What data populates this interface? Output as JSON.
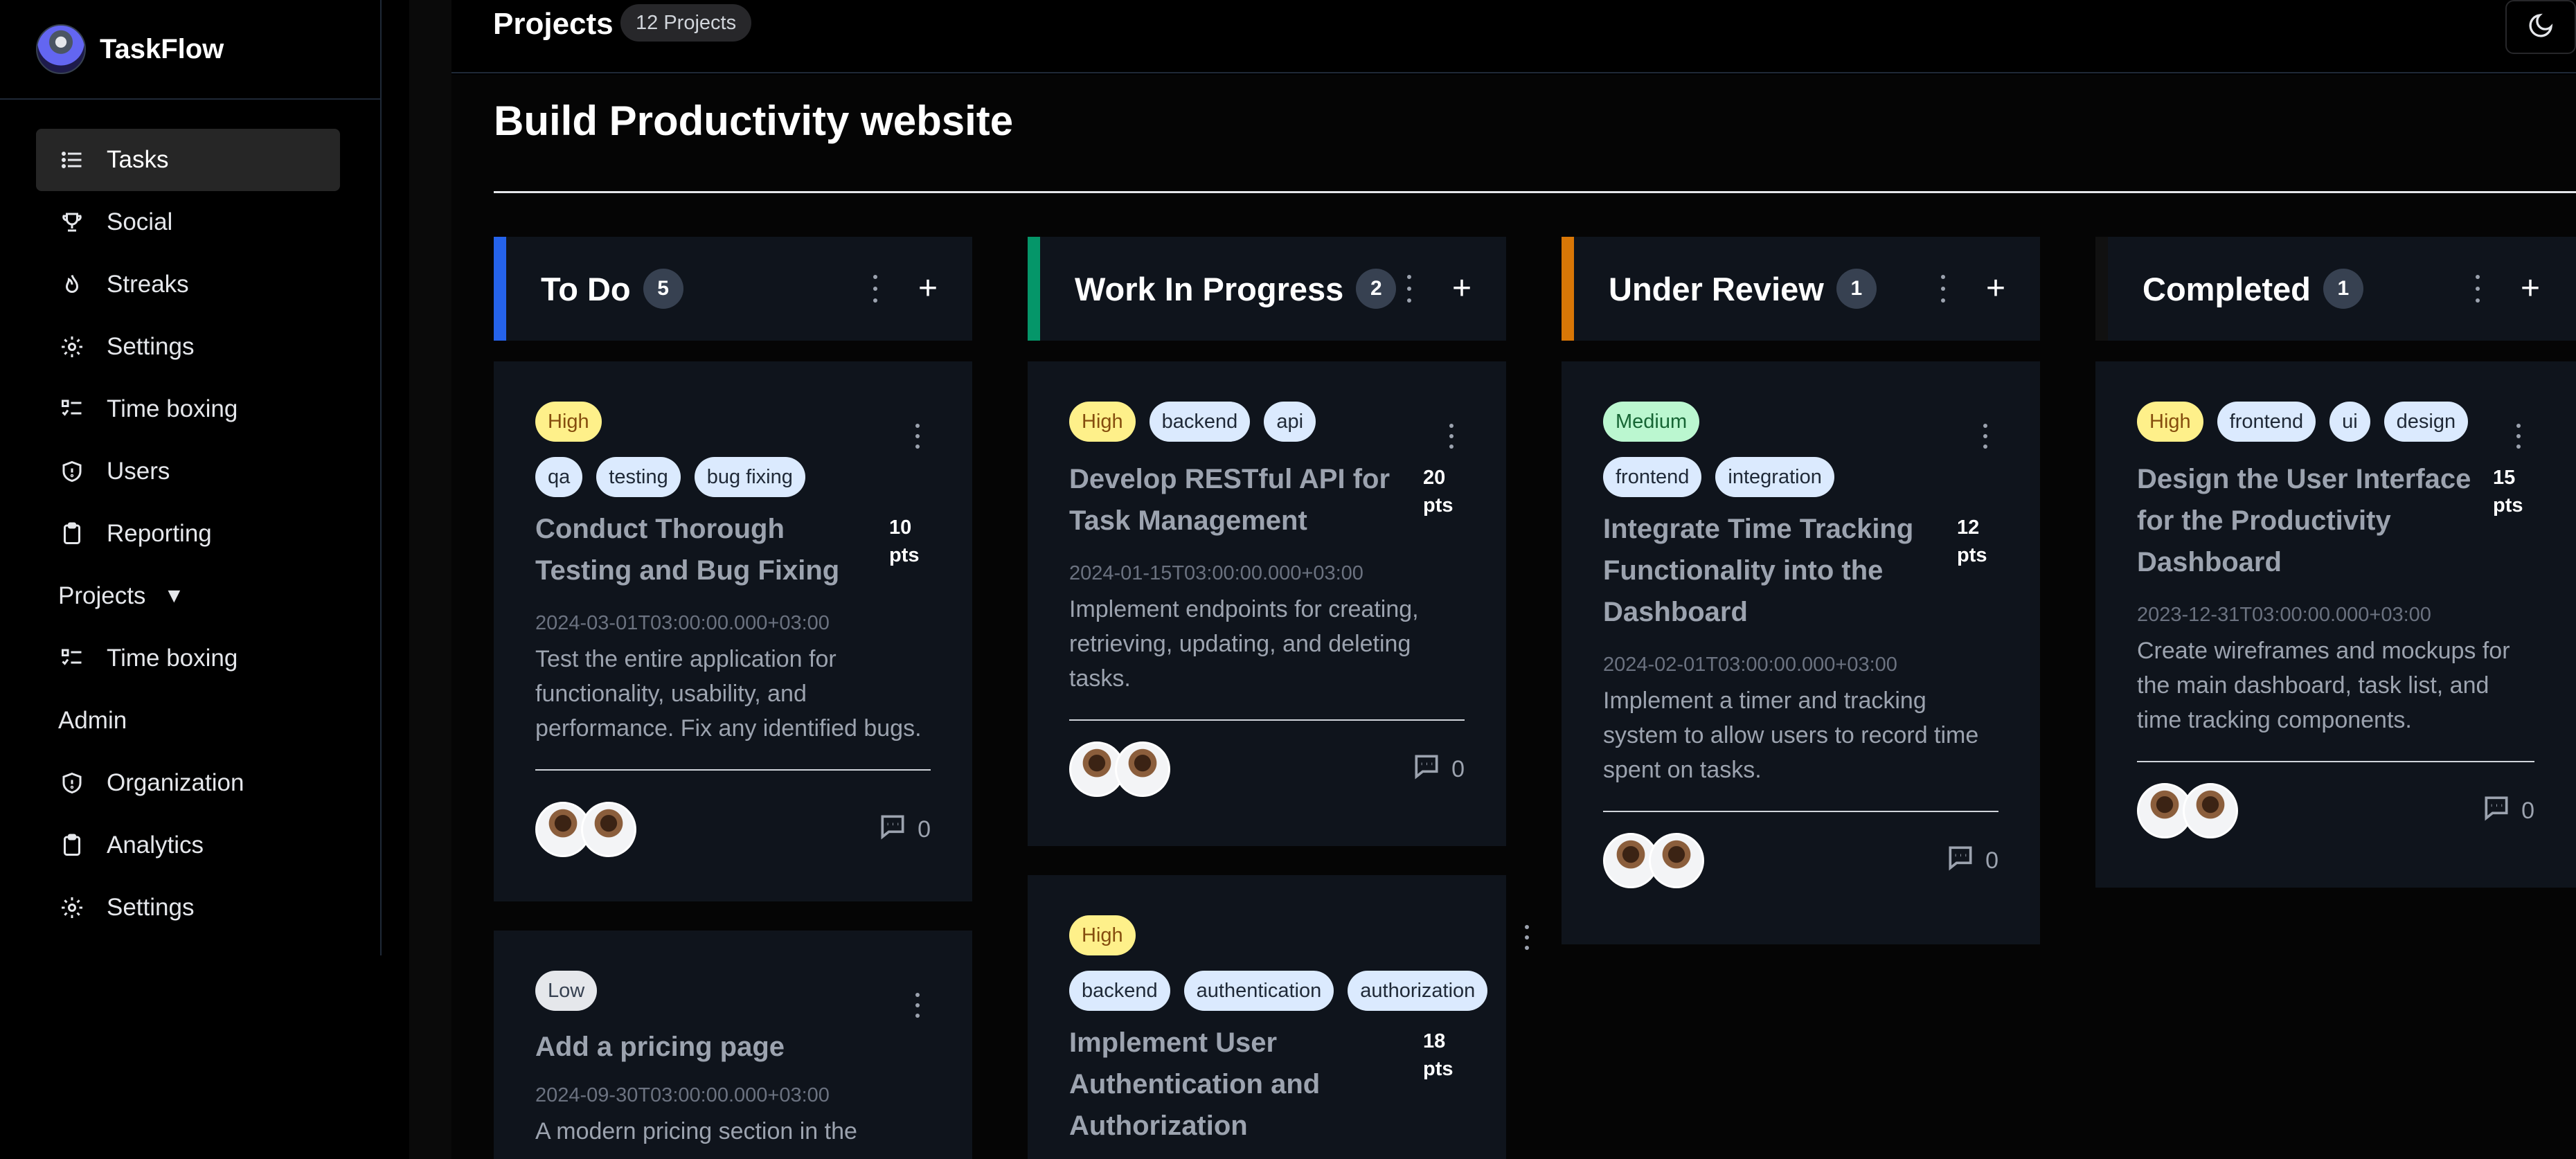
{
  "brand": {
    "name": "TaskFlow"
  },
  "sidebar": {
    "items": [
      {
        "label": "Tasks",
        "icon": "list-icon",
        "active": true
      },
      {
        "label": "Social",
        "icon": "trophy-icon"
      },
      {
        "label": "Streaks",
        "icon": "flame-icon"
      },
      {
        "label": "Settings",
        "icon": "gear-icon"
      },
      {
        "label": "Time boxing",
        "icon": "checklist-icon"
      },
      {
        "label": "Users",
        "icon": "shield-icon"
      },
      {
        "label": "Reporting",
        "icon": "clipboard-icon"
      }
    ],
    "projects_label": "Projects",
    "projects_items": [
      {
        "label": "Time boxing",
        "icon": "checklist-icon"
      }
    ],
    "admin_label": "Admin",
    "admin_items": [
      {
        "label": "Organization",
        "icon": "shield-icon"
      },
      {
        "label": "Analytics",
        "icon": "clipboard-icon"
      },
      {
        "label": "Settings",
        "icon": "gear-icon"
      }
    ]
  },
  "header": {
    "title": "Projects",
    "count_badge": "12 Projects",
    "theme_toggle_icon": "moon-icon"
  },
  "project": {
    "title": "Build Productivity website"
  },
  "columns": [
    {
      "title": "To Do",
      "count": "5",
      "accent": "#2563eb",
      "cards": [
        {
          "priority": "High",
          "tags": [
            "qa",
            "testing",
            "bug fixing"
          ],
          "title": "Conduct Thorough Testing and Bug Fixing",
          "points": "10 pts",
          "date": "2024-03-01T03:00:00.000+03:00",
          "description": "Test the entire application for functionality, usability, and performance. Fix any identified bugs.",
          "comments": "0"
        },
        {
          "priority": "Low",
          "tags": [],
          "title": "Add a pricing page",
          "points": "",
          "date": "2024-09-30T03:00:00.000+03:00",
          "description": "A modern pricing section in the",
          "comments": ""
        }
      ]
    },
    {
      "title": "Work In Progress",
      "count": "2",
      "accent": "#059669",
      "cards": [
        {
          "priority": "High",
          "tags": [
            "backend",
            "api"
          ],
          "title": "Develop RESTful API for Task Management",
          "points": "20 pts",
          "date": "2024-01-15T03:00:00.000+03:00",
          "description": "Implement endpoints for creating, retrieving, updating, and deleting tasks.",
          "comments": "0"
        },
        {
          "priority": "High",
          "tags": [
            "backend",
            "authentication",
            "authorization"
          ],
          "title": "Implement User Authentication and Authorization",
          "points": "18 pts",
          "date": "",
          "description": "",
          "comments": ""
        }
      ]
    },
    {
      "title": "Under Review",
      "count": "1",
      "accent": "#d97706",
      "cards": [
        {
          "priority": "Medium",
          "tags": [
            "frontend",
            "integration"
          ],
          "title": "Integrate Time Tracking Functionality into the Dashboard",
          "points": "12 pts",
          "date": "2024-02-01T03:00:00.000+03:00",
          "description": "Implement a timer and tracking system to allow users to record time spent on tasks.",
          "comments": "0"
        }
      ]
    },
    {
      "title": "Completed",
      "count": "1",
      "accent": "#111111",
      "cards": [
        {
          "priority": "High",
          "tags": [
            "frontend",
            "ui",
            "design"
          ],
          "title": "Design the User Interface for the Productivity Dashboard",
          "points": "15 pts",
          "date": "2023-12-31T03:00:00.000+03:00",
          "description": "Create wireframes and mockups for the main dashboard, task list, and time tracking components.",
          "comments": "0"
        }
      ]
    }
  ]
}
